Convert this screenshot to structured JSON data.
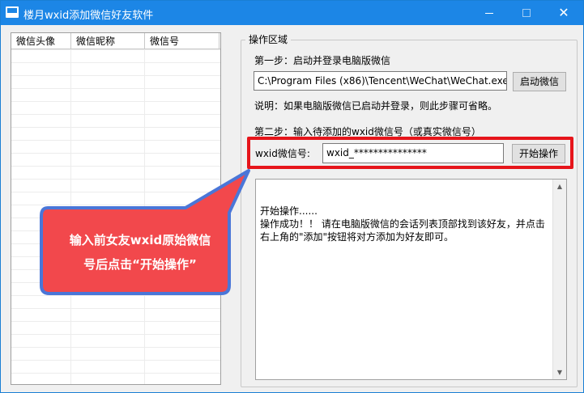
{
  "window": {
    "title": "楼月wxid添加微信好友软件",
    "controls": {
      "minimize": "—",
      "maximize": "□",
      "close": "✕"
    }
  },
  "friend_list": {
    "columns": [
      "微信头像",
      "微信昵称",
      "微信号"
    ],
    "rows": []
  },
  "operation_area": {
    "legend": "操作区域",
    "step1_label": "第一步：启动并登录电脑版微信",
    "wechat_path": "C:\\Program Files (x86)\\Tencent\\WeChat\\WeChat.exe",
    "launch_button": "启动微信",
    "note": "说明：如果电脑版微信已启动并登录，则此步骤可省略。",
    "step2_label": "第二步：输入待添加的wxid微信号（或真实微信号）",
    "wxid_label": "wxid微信号:",
    "wxid_value": "wxid_***************",
    "start_button": "开始操作",
    "log_text": "开始操作......\n操作成功！！ 请在电脑版微信的会话列表顶部找到该好友，并点击右上角的\"添加\"按钮将对方添加为好友即可。"
  },
  "callout": {
    "line1": "输入前女友wxid原始微信",
    "line2": "号后点击“开始操作”",
    "color": "#f2484c",
    "border": "#4a76d8"
  },
  "colors": {
    "titlebar": "#1c86e6",
    "highlight": "#e6151b"
  }
}
